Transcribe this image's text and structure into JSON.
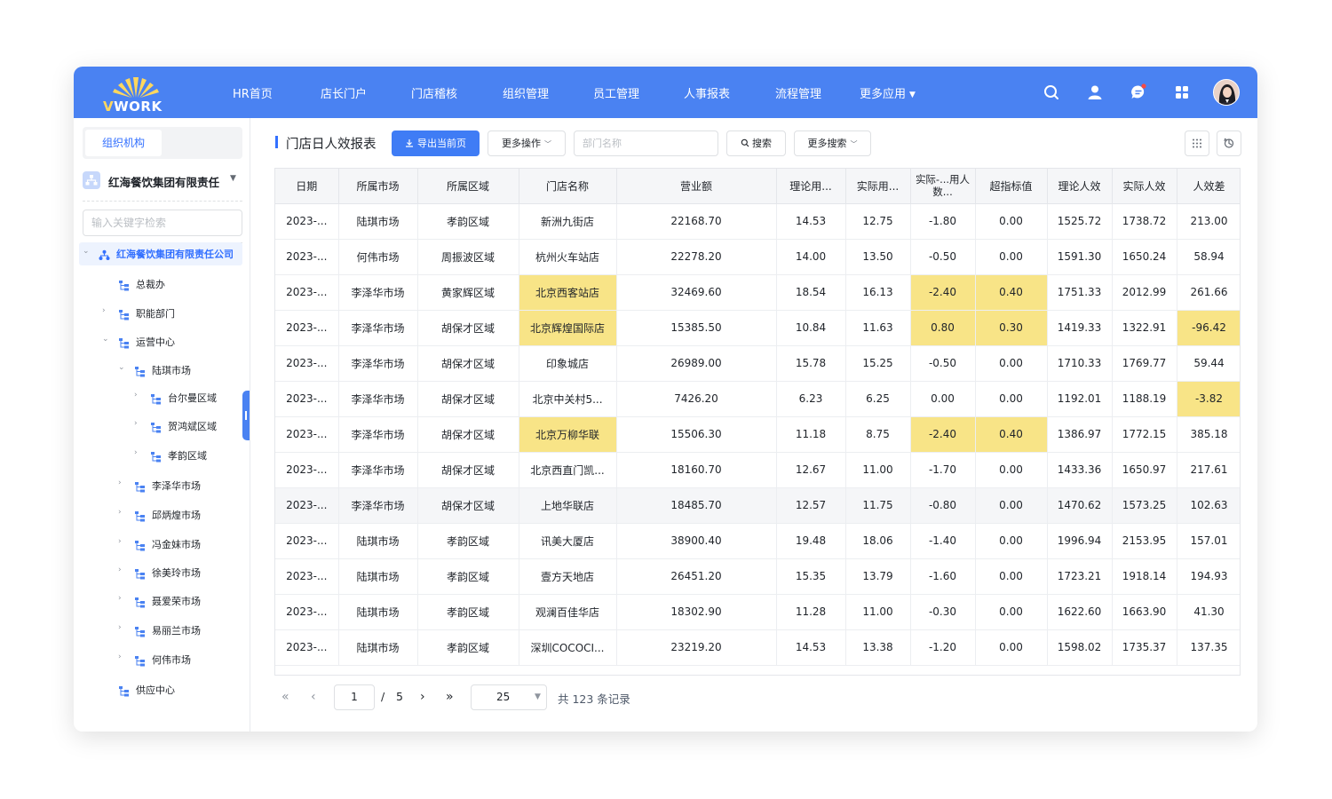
{
  "brand": {
    "logo_text": "VWORK",
    "logo_v": "V",
    "logo_rest": "WORK",
    "accent": "#4a82f2",
    "sun_color": "#ffd75e"
  },
  "nav": {
    "items": [
      "HR首页",
      "店长门户",
      "门店稽核",
      "组织管理",
      "员工管理",
      "人事报表",
      "流程管理",
      "更多应用"
    ],
    "header_icons": [
      "search-icon",
      "user-icon",
      "message-icon",
      "apps-grid-icon",
      "avatar"
    ]
  },
  "sidebar": {
    "tab_label": "组织机构",
    "org_name": "红海餐饮集团有限责任",
    "search_placeholder": "输入关键字检索",
    "tree": [
      {
        "label": "红海餐饮集团有限责任公司",
        "level": 0,
        "state": "expanded",
        "selected": true
      },
      {
        "label": "总裁办",
        "level": 1,
        "state": "leaf"
      },
      {
        "label": "职能部门",
        "level": 1,
        "state": "collapsed"
      },
      {
        "label": "运营中心",
        "level": 1,
        "state": "expanded"
      },
      {
        "label": "陆琪市场",
        "level": 2,
        "state": "expanded"
      },
      {
        "label": "台尔曼区域",
        "level": 3,
        "state": "collapsed"
      },
      {
        "label": "贺鸿斌区域",
        "level": 3,
        "state": "collapsed"
      },
      {
        "label": "孝韵区域",
        "level": 3,
        "state": "collapsed"
      },
      {
        "label": "李泽华市场",
        "level": 2,
        "state": "collapsed"
      },
      {
        "label": "邱炳煌市场",
        "level": 2,
        "state": "collapsed"
      },
      {
        "label": "冯金妹市场",
        "level": 2,
        "state": "collapsed"
      },
      {
        "label": "徐美玲市场",
        "level": 2,
        "state": "collapsed"
      },
      {
        "label": "聂爱荣市场",
        "level": 2,
        "state": "collapsed"
      },
      {
        "label": "易丽兰市场",
        "level": 2,
        "state": "collapsed"
      },
      {
        "label": "何伟市场",
        "level": 2,
        "state": "collapsed"
      },
      {
        "label": "供应中心",
        "level": 1,
        "state": "leaf"
      }
    ]
  },
  "toolbar": {
    "title": "门店日人效报表",
    "export_label": "导出当前页",
    "more_ops_label": "更多操作",
    "dept_placeholder": "部门名称",
    "search_label": "搜索",
    "more_search_label": "更多搜索"
  },
  "table": {
    "headers": [
      "日期",
      "所属市场",
      "所属区域",
      "门店名称",
      "营业额",
      "理论用...",
      "实际用...",
      "实际-...用人数...",
      "超指标值",
      "理论人效",
      "实际人效",
      "人效差"
    ],
    "rows": [
      [
        "2023-...",
        "陆琪市场",
        "孝韵区域",
        "新洲九街店",
        "22168.70",
        "14.53",
        "12.75",
        "-1.80",
        "0.00",
        "1525.72",
        "1738.72",
        "213.00"
      ],
      [
        "2023-...",
        "何伟市场",
        "周振波区域",
        "杭州火车站店",
        "22278.20",
        "14.00",
        "13.50",
        "-0.50",
        "0.00",
        "1591.30",
        "1650.24",
        "58.94"
      ],
      [
        "2023-...",
        "李泽华市场",
        "黄家辉区域",
        "北京西客站店",
        "32469.60",
        "18.54",
        "16.13",
        "-2.40",
        "0.40",
        "1751.33",
        "2012.99",
        "261.66"
      ],
      [
        "2023-...",
        "李泽华市场",
        "胡保才区域",
        "北京辉煌国际店",
        "15385.50",
        "10.84",
        "11.63",
        "0.80",
        "0.30",
        "1419.33",
        "1322.91",
        "-96.42"
      ],
      [
        "2023-...",
        "李泽华市场",
        "胡保才区域",
        "印象城店",
        "26989.00",
        "15.78",
        "15.25",
        "-0.50",
        "0.00",
        "1710.33",
        "1769.77",
        "59.44"
      ],
      [
        "2023-...",
        "李泽华市场",
        "胡保才区域",
        "北京中关村5...",
        "7426.20",
        "6.23",
        "6.25",
        "0.00",
        "0.00",
        "1192.01",
        "1188.19",
        "-3.82"
      ],
      [
        "2023-...",
        "李泽华市场",
        "胡保才区域",
        "北京万柳华联",
        "15506.30",
        "11.18",
        "8.75",
        "-2.40",
        "0.40",
        "1386.97",
        "1772.15",
        "385.18"
      ],
      [
        "2023-...",
        "李泽华市场",
        "胡保才区域",
        "北京西直门凯...",
        "18160.70",
        "12.67",
        "11.00",
        "-1.70",
        "0.00",
        "1433.36",
        "1650.97",
        "217.61"
      ],
      [
        "2023-...",
        "李泽华市场",
        "胡保才区域",
        "上地华联店",
        "18485.70",
        "12.57",
        "11.75",
        "-0.80",
        "0.00",
        "1470.62",
        "1573.25",
        "102.63"
      ],
      [
        "2023-...",
        "陆琪市场",
        "孝韵区域",
        "讯美大厦店",
        "38900.40",
        "19.48",
        "18.06",
        "-1.40",
        "0.00",
        "1996.94",
        "2153.95",
        "157.01"
      ],
      [
        "2023-...",
        "陆琪市场",
        "孝韵区域",
        "壹方天地店",
        "26451.20",
        "15.35",
        "13.79",
        "-1.60",
        "0.00",
        "1723.21",
        "1918.14",
        "194.93"
      ],
      [
        "2023-...",
        "陆琪市场",
        "孝韵区域",
        "观澜百佳华店",
        "18302.90",
        "11.28",
        "11.00",
        "-0.30",
        "0.00",
        "1622.60",
        "1663.90",
        "41.30"
      ],
      [
        "2023-...",
        "陆琪市场",
        "孝韵区域",
        "深圳COCOCI...",
        "23219.20",
        "14.53",
        "13.38",
        "-1.20",
        "0.00",
        "1598.02",
        "1735.37",
        "137.35"
      ]
    ],
    "highlights": [
      [
        2,
        3
      ],
      [
        2,
        7
      ],
      [
        2,
        8
      ],
      [
        3,
        3
      ],
      [
        3,
        7
      ],
      [
        3,
        8
      ],
      [
        3,
        11
      ],
      [
        5,
        11
      ],
      [
        6,
        3
      ],
      [
        6,
        7
      ],
      [
        6,
        8
      ]
    ],
    "highlight_color": "#f8e487",
    "hover_row": 8
  },
  "pager": {
    "page": "1",
    "separator": "/",
    "total_pages": "5",
    "page_size": "25",
    "total_text": "共 123 条记录"
  }
}
